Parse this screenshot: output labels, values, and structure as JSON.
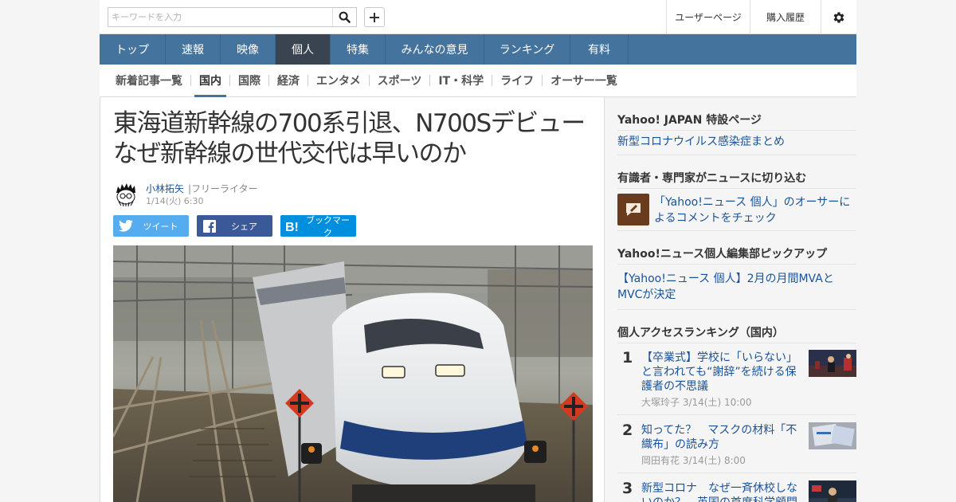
{
  "search": {
    "placeholder": "キーワードを入力"
  },
  "header": {
    "user_page": "ユーザーページ",
    "purchase_history": "購入履歴"
  },
  "mainnav": [
    {
      "label": "トップ",
      "active": false
    },
    {
      "label": "速報",
      "active": false
    },
    {
      "label": "映像",
      "active": false
    },
    {
      "label": "個人",
      "active": true
    },
    {
      "label": "特集",
      "active": false
    },
    {
      "label": "みんなの意見",
      "active": false
    },
    {
      "label": "ランキング",
      "active": false
    },
    {
      "label": "有料",
      "active": false
    }
  ],
  "subnav": [
    {
      "label": "新着記事一覧",
      "active": false
    },
    {
      "label": "国内",
      "active": true
    },
    {
      "label": "国際",
      "active": false
    },
    {
      "label": "経済",
      "active": false
    },
    {
      "label": "エンタメ",
      "active": false
    },
    {
      "label": "スポーツ",
      "active": false
    },
    {
      "label": "IT・科学",
      "active": false
    },
    {
      "label": "ライフ",
      "active": false
    },
    {
      "label": "オーサー一覧",
      "active": false
    }
  ],
  "article": {
    "title_line1": "東海道新幹線の700系引退、N700Sデビュー",
    "title_line2": "なぜ新幹線の世代交代は早いのか",
    "author": "小林拓矢",
    "author_role": "|フリーライター",
    "date": "1/14(火) 6:30",
    "share": {
      "tweet": "ツイート",
      "facebook": "シェア",
      "bookmark": "ブックマーク"
    }
  },
  "sidebar": {
    "special": {
      "title": "Yahoo! JAPAN 特設ページ",
      "link": "新型コロナウイルス感染症まとめ"
    },
    "experts": {
      "title": "有識者・専門家がニュースに切り込む",
      "link": "「Yahoo!ニュース 個人」のオーサーによるコメントをチェック"
    },
    "pickup": {
      "title": "Yahoo!ニュース個人編集部ピックアップ",
      "link": "【Yahoo!ニュース 個人】2月の月間MVAとMVCが決定"
    },
    "ranking": {
      "title": "個人アクセスランキング（国内）",
      "items": [
        {
          "rank": "1",
          "title": "【卒業式】学校に「いらない」と言われても“謝辞”を続ける保護者の不思議",
          "meta": "大塚玲子 3/14(土) 10:00"
        },
        {
          "rank": "2",
          "title": "知ってた？　マスクの材料「不織布」の読み方",
          "meta": "岡田有花 3/14(土) 8:00"
        },
        {
          "rank": "3",
          "title": "新型コロナ　なぜ一斉休校しないのか？　英国の首席科学顧問",
          "meta": ""
        }
      ]
    }
  },
  "colors": {
    "nav_blue": "#44749d",
    "nav_active": "#3a4350",
    "link_blue": "#1a5296",
    "twitter": "#55acee",
    "facebook": "#3b5998",
    "hatena": "#008fde"
  }
}
